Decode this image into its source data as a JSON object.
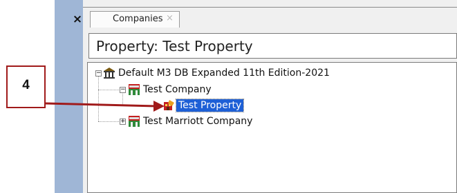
{
  "window": {
    "close_glyph": "×"
  },
  "tab": {
    "label": "Companies",
    "close_glyph": "×"
  },
  "header": {
    "title": "Property: Test Property"
  },
  "tree": {
    "root": {
      "label": "Default M3 DB Expanded 11th Edition-2021",
      "expander": "−",
      "icon": "database-pillars-icon"
    },
    "items": [
      {
        "label": "Test Company",
        "expander": "−",
        "icon": "company-icon",
        "selected": false
      },
      {
        "label": "Test Property",
        "icon": "property-icon",
        "selected": true
      },
      {
        "label": "Test Marriott Company",
        "expander": "+",
        "icon": "company-icon",
        "selected": false
      }
    ]
  },
  "callout": {
    "number": "4",
    "color": "#a01a1a"
  },
  "colors": {
    "side_strip": "#9fb6d6",
    "selection": "#1e60d6"
  }
}
